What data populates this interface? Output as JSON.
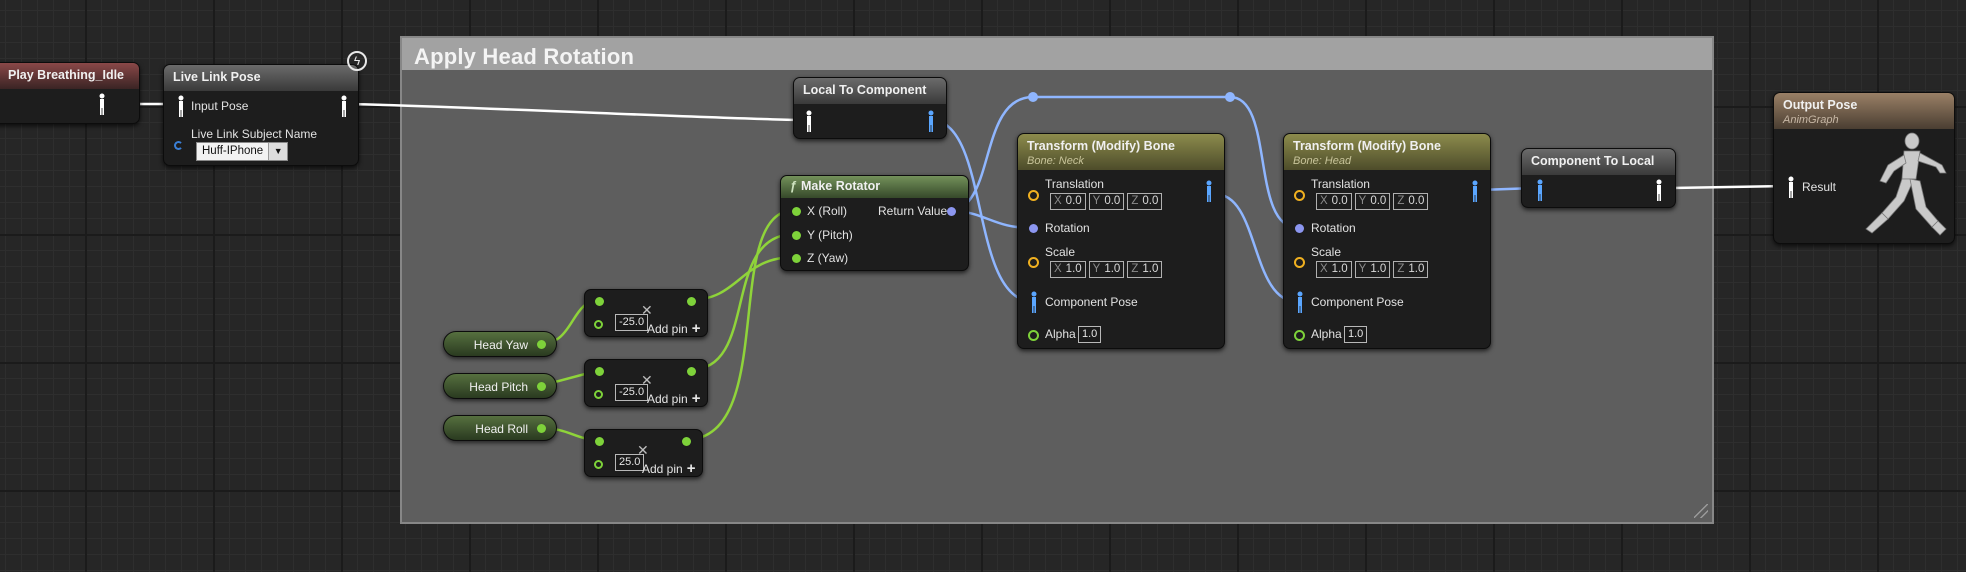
{
  "comment": {
    "title": "Apply Head Rotation"
  },
  "nodes": {
    "play_breathing": {
      "title": "Play Breathing_Idle"
    },
    "live_link_pose": {
      "title": "Live Link Pose",
      "input_pose": "Input Pose",
      "subject_label": "Live Link Subject Name",
      "subject_value": "Huff-IPhone"
    },
    "local_to_component": {
      "title": "Local To Component"
    },
    "make_rotator": {
      "title": "Make Rotator",
      "x": "X (Roll)",
      "y": "Y (Pitch)",
      "z": "Z (Yaw)",
      "ret": "Return Value"
    },
    "tmb_neck": {
      "title": "Transform (Modify) Bone",
      "subtitle": "Bone: Neck",
      "translation": "Translation",
      "t": [
        "0.0",
        "0.0",
        "0.0"
      ],
      "rotation": "Rotation",
      "scale": "Scale",
      "s": [
        "1.0",
        "1.0",
        "1.0"
      ],
      "component_pose": "Component Pose",
      "alpha": "Alpha",
      "alpha_value": "1.0"
    },
    "tmb_head": {
      "title": "Transform (Modify) Bone",
      "subtitle": "Bone: Head",
      "translation": "Translation",
      "t": [
        "0.0",
        "0.0",
        "0.0"
      ],
      "rotation": "Rotation",
      "scale": "Scale",
      "s": [
        "1.0",
        "1.0",
        "1.0"
      ],
      "component_pose": "Component Pose",
      "alpha": "Alpha",
      "alpha_value": "1.0"
    },
    "component_to_local": {
      "title": "Component To Local"
    },
    "output_pose": {
      "title": "Output Pose",
      "subtitle": "AnimGraph",
      "result": "Result"
    }
  },
  "axis_keys": [
    "X",
    "Y",
    "Z"
  ],
  "variables": [
    "Head Yaw",
    "Head Pitch",
    "Head Roll"
  ],
  "multiply_nodes": [
    {
      "value": "-25.0",
      "add_pin": "Add pin"
    },
    {
      "value": "-25.0",
      "add_pin": "Add pin"
    },
    {
      "value": "25.0",
      "add_pin": "Add pin"
    }
  ],
  "colors": {
    "exec_wire": "#ffffff",
    "pose_wire": "#8fb6ff",
    "float_wire": "#8fd43a",
    "comment_bg": "#5e5e5e"
  }
}
